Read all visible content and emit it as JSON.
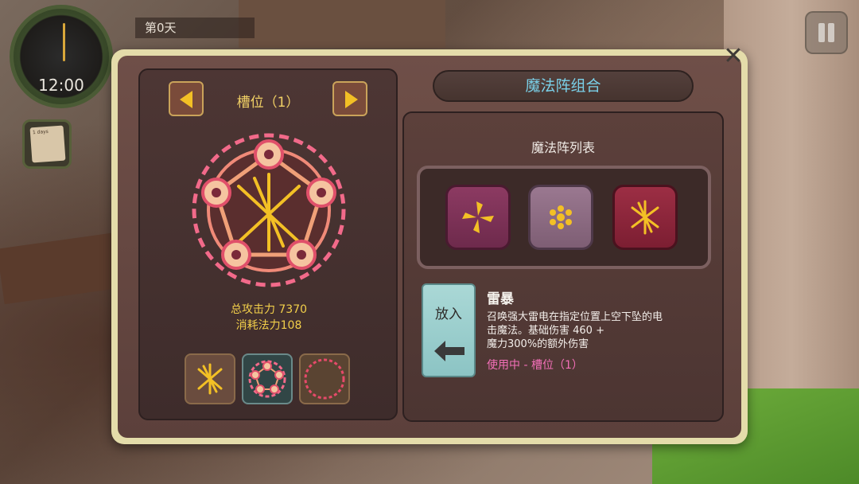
{
  "hud": {
    "clock_time": "12:00",
    "day_label": "第0天",
    "note_text": "1 days",
    "pause_icon": "pause-icon"
  },
  "dialog": {
    "title": "魔法阵组合",
    "close_icon": "close-icon"
  },
  "slot_panel": {
    "title": "槽位（1）",
    "total_attack": "总攻击力 7370",
    "mana_cost": "消耗法力108",
    "slot_buttons": [
      "lightning-rune-icon",
      "pentagram-circle-icon",
      "empty-circle-icon"
    ]
  },
  "list_panel": {
    "title": "魔法阵列表",
    "tiles": [
      {
        "icon": "shuriken-icon",
        "color": "#8c3a62"
      },
      {
        "icon": "flower-icon",
        "color": "#9a7890"
      },
      {
        "icon": "lightning-rune-icon",
        "color": "#9c2e44"
      }
    ]
  },
  "detail": {
    "put_button": "放入",
    "spell_name": "雷暴",
    "spell_desc_line1": "召唤强大雷电在指定位置上空下坠的电",
    "spell_desc_line2": "击魔法。基础伤害 460 +",
    "spell_desc_line3": "魔力300%的额外伤害",
    "status": "使用中 - 槽位（1）"
  },
  "colors": {
    "accent_gold": "#f3c025",
    "title_cyan": "#7ad0e8",
    "status_pink": "#f36fb8",
    "circle_pink": "#f26a8a"
  }
}
